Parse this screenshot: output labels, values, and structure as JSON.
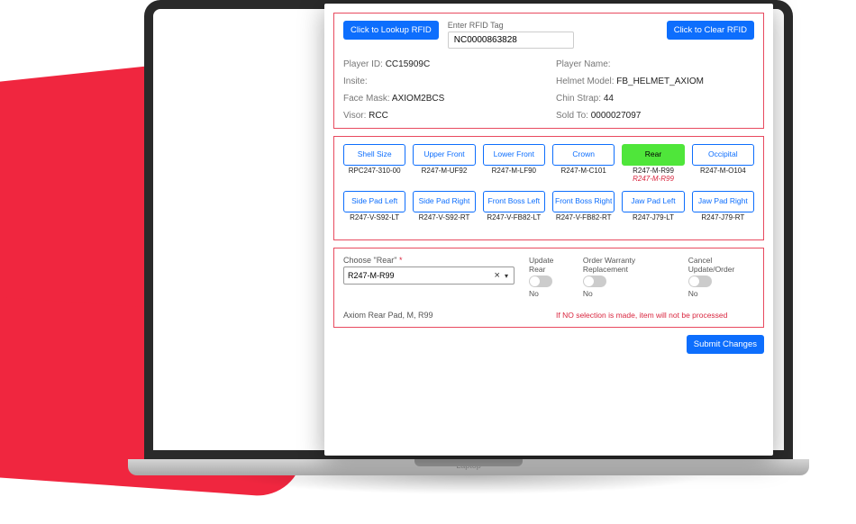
{
  "laptop_label": "Laptop",
  "top": {
    "lookup_btn": "Click to Lookup RFID",
    "clear_btn": "Click to Clear RFID",
    "rfid_label": "Enter RFID Tag",
    "rfid_value": "NC0000863828"
  },
  "info": {
    "player_id_label": "Player ID:",
    "player_id_value": "CC15909C",
    "player_name_label": "Player Name:",
    "player_name_value": "",
    "insite_label": "Insite:",
    "insite_value": "",
    "helmet_model_label": "Helmet Model:",
    "helmet_model_value": "FB_HELMET_AXIOM",
    "face_mask_label": "Face Mask:",
    "face_mask_value": "AXIOM2BCS",
    "chin_strap_label": "Chin Strap:",
    "chin_strap_value": "44",
    "visor_label": "Visor:",
    "visor_value": "RCC",
    "sold_to_label": "Sold To:",
    "sold_to_value": "0000027097"
  },
  "categories": [
    {
      "label": "Shell Size",
      "code": "RPC247-310-00",
      "sub": ""
    },
    {
      "label": "Upper Front",
      "code": "R247-M-UF92",
      "sub": ""
    },
    {
      "label": "Lower Front",
      "code": "R247-M-LF90",
      "sub": ""
    },
    {
      "label": "Crown",
      "code": "R247-M-C101",
      "sub": ""
    },
    {
      "label": "Rear",
      "code": "R247-M-R99",
      "sub": "R247-M-R99",
      "active": true
    },
    {
      "label": "Occipital",
      "code": "R247-M-O104",
      "sub": ""
    },
    {
      "label": "Side Pad Left",
      "code": "R247-V-S92-LT",
      "sub": ""
    },
    {
      "label": "Side Pad Right",
      "code": "R247-V-S92-RT",
      "sub": ""
    },
    {
      "label": "Front Boss Left",
      "code": "R247-V-FB82-LT",
      "sub": ""
    },
    {
      "label": "Front Boss Right",
      "code": "R247-V-FB82-RT",
      "sub": ""
    },
    {
      "label": "Jaw Pad Left",
      "code": "R247-J79-LT",
      "sub": ""
    },
    {
      "label": "Jaw Pad Right",
      "code": "R247-J79-RT",
      "sub": ""
    }
  ],
  "choose": {
    "label_prefix": "Choose \"Rear\"",
    "required_mark": "*",
    "value": "R247-M-R99",
    "description": "Axiom Rear Pad, M, R99",
    "update_label": "Update Rear",
    "update_state": "No",
    "warranty_label": "Order Warranty Replacement",
    "warranty_state": "No",
    "cancel_label": "Cancel Update/Order",
    "cancel_state": "No",
    "warning": "If NO selection is made, item will not be processed"
  },
  "submit_btn": "Submit Changes"
}
